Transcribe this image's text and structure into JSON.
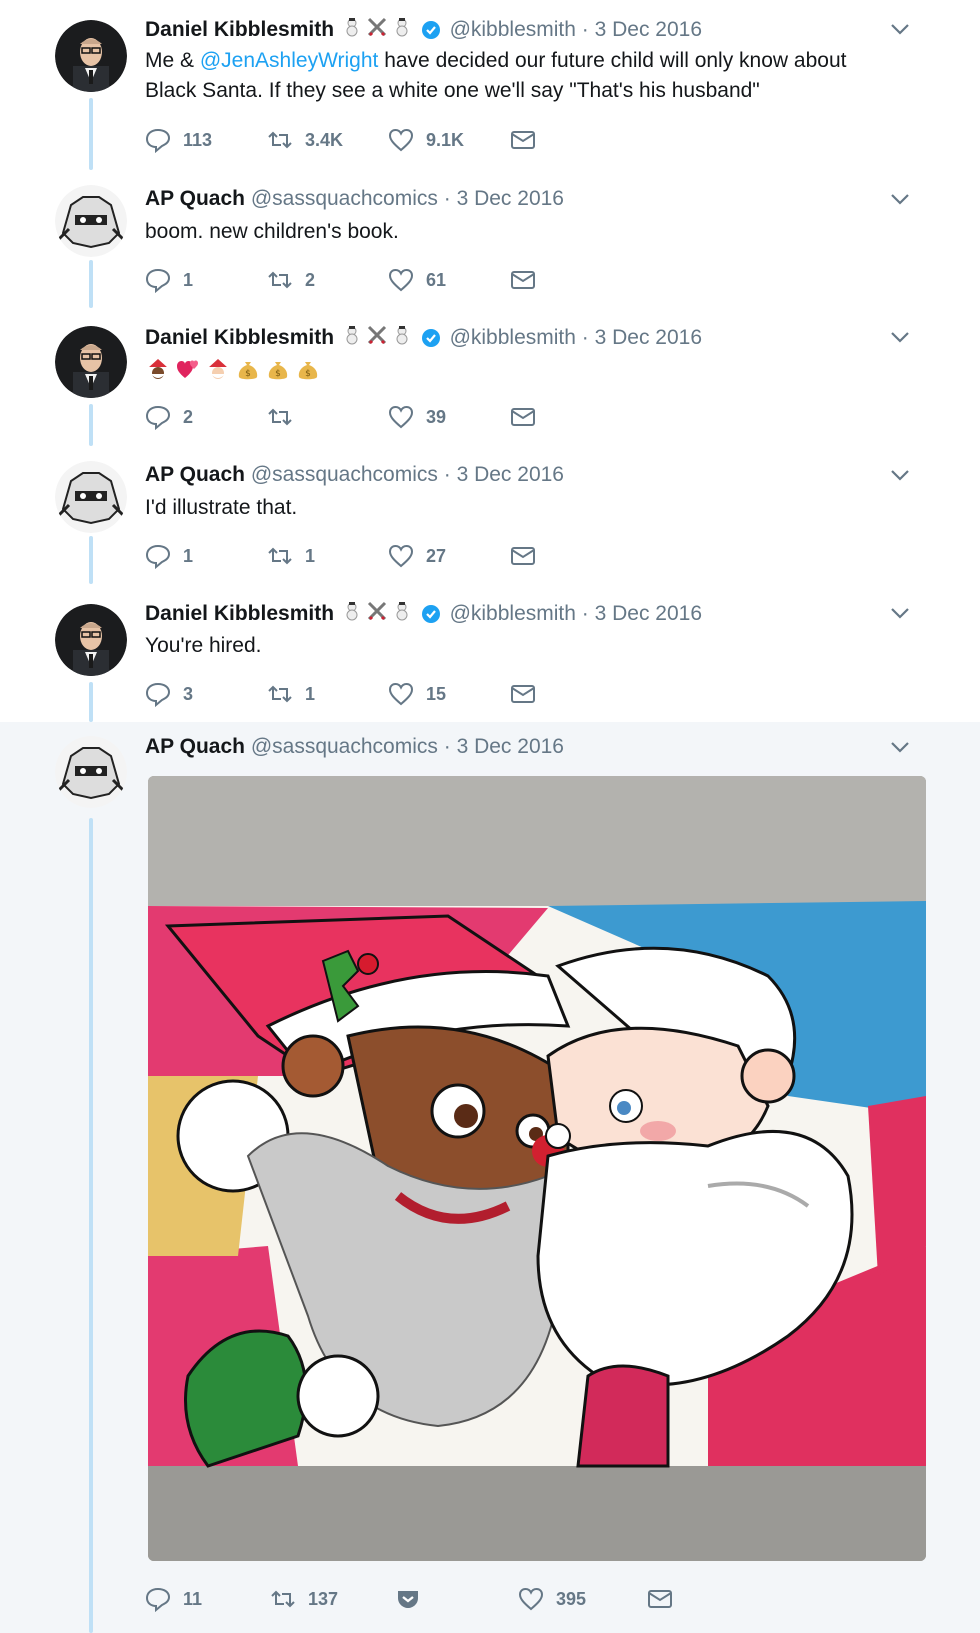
{
  "tweets": [
    {
      "name": "Daniel Kibblesmith",
      "handle": "@kibblesmith",
      "date": "3 Dec 2016",
      "text_prefix": "Me & ",
      "mention": "@JenAshleyWright",
      "text_line1_rest": " have decided our future child will only know about",
      "text_line2": "Black Santa. If they see a white one we'll say \"That's his husband\"",
      "reply_count": "113",
      "retweet_count": "3.4K",
      "like_count": "9.1K"
    },
    {
      "name": "AP Quach",
      "handle": "@sassquachcomics",
      "date": "3 Dec 2016",
      "text": "boom. new children's book.",
      "reply_count": "1",
      "retweet_count": "2",
      "like_count": "61"
    },
    {
      "name": "Daniel Kibblesmith",
      "handle": "@kibblesmith",
      "date": "3 Dec 2016",
      "emojis": [
        "santa-dark-emoji",
        "hearts-emoji",
        "santa-emoji",
        "money-bag-emoji",
        "money-bag-emoji",
        "money-bag-emoji"
      ],
      "reply_count": "2",
      "retweet_count": "",
      "like_count": "39"
    },
    {
      "name": "AP Quach",
      "handle": "@sassquachcomics",
      "date": "3 Dec 2016",
      "text": "I'd illustrate that.",
      "reply_count": "1",
      "retweet_count": "1",
      "like_count": "27"
    },
    {
      "name": "Daniel Kibblesmith",
      "handle": "@kibblesmith",
      "date": "3 Dec 2016",
      "text": "You're hired.",
      "reply_count": "3",
      "retweet_count": "1",
      "like_count": "15"
    },
    {
      "name": "AP Quach",
      "handle": "@sassquachcomics",
      "date": "3 Dec 2016",
      "media": "illustration of two Santa Claus figures cheek to cheek",
      "reply_count": "11",
      "retweet_count": "137",
      "like_count": "395"
    }
  ],
  "separator": "·",
  "colors": {
    "text": "#14171a",
    "muted": "#657786",
    "link": "#1da1f2",
    "thread_line": "#bfe0f6",
    "highlight_bg": "#f3f6f9"
  }
}
